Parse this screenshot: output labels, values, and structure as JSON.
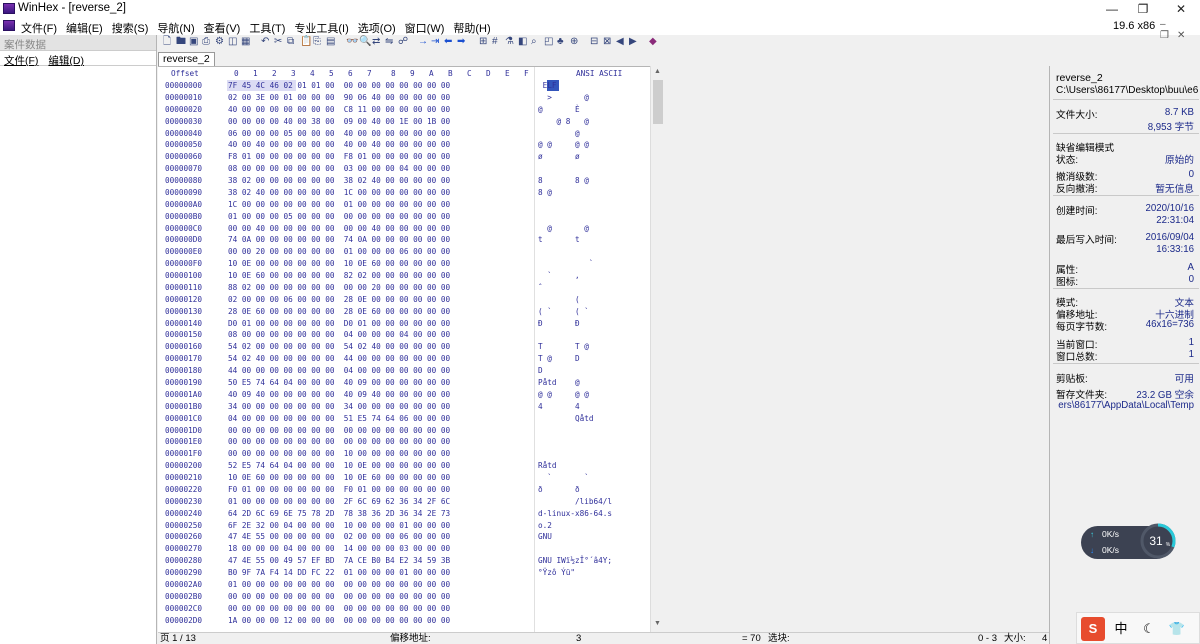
{
  "window": {
    "app_name": "WinHex",
    "title": "WinHex - [reverse_2]",
    "minimize_icon": "—",
    "maximize_icon": "❐",
    "close_icon": "✕"
  },
  "menubar": {
    "items": [
      "文件(F)",
      "编辑(E)",
      "搜索(S)",
      "导航(N)",
      "查看(V)",
      "工具(T)",
      "专业工具(I)",
      "选项(O)",
      "窗口(W)",
      "帮助(H)"
    ],
    "version": "19.6 x86"
  },
  "case_panel": {
    "title": "案件数据",
    "menu": [
      "文件(F)",
      "编辑(D)"
    ]
  },
  "tabs": [
    "reverse_2"
  ],
  "hex_header": {
    "offset_label": "Offset",
    "columns": [
      "0",
      "1",
      "2",
      "3",
      "4",
      "5",
      "6",
      "7",
      "8",
      "9",
      "A",
      "B",
      "C",
      "D",
      "E",
      "F"
    ],
    "ascii_label": "ANSI ASCII"
  },
  "hex_rows": [
    {
      "offset": "00000000",
      "hex": "7F 45 4C 46 02 01 01 00  00 00 00 00 00 00 00 00",
      "ascii": " ELF"
    },
    {
      "offset": "00000010",
      "hex": "02 00 3E 00 01 00 00 00  90 06 40 00 00 00 00 00",
      "ascii": "  >       @"
    },
    {
      "offset": "00000020",
      "hex": "40 00 00 00 00 00 00 00  C8 11 00 00 00 00 00 00",
      "ascii": "@       È"
    },
    {
      "offset": "00000030",
      "hex": "00 00 00 00 40 00 38 00  09 00 40 00 1E 00 1B 00",
      "ascii": "    @ 8   @"
    },
    {
      "offset": "00000040",
      "hex": "06 00 00 00 05 00 00 00  40 00 00 00 00 00 00 00",
      "ascii": "        @"
    },
    {
      "offset": "00000050",
      "hex": "40 00 40 00 00 00 00 00  40 00 40 00 00 00 00 00",
      "ascii": "@ @     @ @"
    },
    {
      "offset": "00000060",
      "hex": "F8 01 00 00 00 00 00 00  F8 01 00 00 00 00 00 00",
      "ascii": "ø       ø"
    },
    {
      "offset": "00000070",
      "hex": "08 00 00 00 00 00 00 00  03 00 00 00 04 00 00 00",
      "ascii": ""
    },
    {
      "offset": "00000080",
      "hex": "38 02 00 00 00 00 00 00  38 02 40 00 00 00 00 00",
      "ascii": "8       8 @"
    },
    {
      "offset": "00000090",
      "hex": "38 02 40 00 00 00 00 00  1C 00 00 00 00 00 00 00",
      "ascii": "8 @"
    },
    {
      "offset": "000000A0",
      "hex": "1C 00 00 00 00 00 00 00  01 00 00 00 00 00 00 00",
      "ascii": ""
    },
    {
      "offset": "000000B0",
      "hex": "01 00 00 00 05 00 00 00  00 00 00 00 00 00 00 00",
      "ascii": ""
    },
    {
      "offset": "000000C0",
      "hex": "00 00 40 00 00 00 00 00  00 00 40 00 00 00 00 00",
      "ascii": "  @       @"
    },
    {
      "offset": "000000D0",
      "hex": "74 0A 00 00 00 00 00 00  74 0A 00 00 00 00 00 00",
      "ascii": "t       t"
    },
    {
      "offset": "000000E0",
      "hex": "00 00 20 00 00 00 00 00  01 00 00 00 06 00 00 00",
      "ascii": ""
    },
    {
      "offset": "000000F0",
      "hex": "10 0E 00 00 00 00 00 00  10 0E 60 00 00 00 00 00",
      "ascii": "           `"
    },
    {
      "offset": "00000100",
      "hex": "10 0E 60 00 00 00 00 00  82 02 00 00 00 00 00 00",
      "ascii": "  `     ‚"
    },
    {
      "offset": "00000110",
      "hex": "88 02 00 00 00 00 00 00  00 00 20 00 00 00 00 00",
      "ascii": "ˆ"
    },
    {
      "offset": "00000120",
      "hex": "02 00 00 00 06 00 00 00  28 0E 00 00 00 00 00 00",
      "ascii": "        ("
    },
    {
      "offset": "00000130",
      "hex": "28 0E 60 00 00 00 00 00  28 0E 60 00 00 00 00 00",
      "ascii": "( `     ( `"
    },
    {
      "offset": "00000140",
      "hex": "D0 01 00 00 00 00 00 00  D0 01 00 00 00 00 00 00",
      "ascii": "Ð       Ð"
    },
    {
      "offset": "00000150",
      "hex": "08 00 00 00 00 00 00 00  04 00 00 00 04 00 00 00",
      "ascii": ""
    },
    {
      "offset": "00000160",
      "hex": "54 02 00 00 00 00 00 00  54 02 40 00 00 00 00 00",
      "ascii": "T       T @"
    },
    {
      "offset": "00000170",
      "hex": "54 02 40 00 00 00 00 00  44 00 00 00 00 00 00 00",
      "ascii": "T @     D"
    },
    {
      "offset": "00000180",
      "hex": "44 00 00 00 00 00 00 00  04 00 00 00 00 00 00 00",
      "ascii": "D"
    },
    {
      "offset": "00000190",
      "hex": "50 E5 74 64 04 00 00 00  40 09 00 00 00 00 00 00",
      "ascii": "Påtd    @"
    },
    {
      "offset": "000001A0",
      "hex": "40 09 40 00 00 00 00 00  40 09 40 00 00 00 00 00",
      "ascii": "@ @     @ @"
    },
    {
      "offset": "000001B0",
      "hex": "34 00 00 00 00 00 00 00  34 00 00 00 00 00 00 00",
      "ascii": "4       4"
    },
    {
      "offset": "000001C0",
      "hex": "04 00 00 00 00 00 00 00  51 E5 74 64 06 00 00 00",
      "ascii": "        Qåtd"
    },
    {
      "offset": "000001D0",
      "hex": "00 00 00 00 00 00 00 00  00 00 00 00 00 00 00 00",
      "ascii": ""
    },
    {
      "offset": "000001E0",
      "hex": "00 00 00 00 00 00 00 00  00 00 00 00 00 00 00 00",
      "ascii": ""
    },
    {
      "offset": "000001F0",
      "hex": "00 00 00 00 00 00 00 00  10 00 00 00 00 00 00 00",
      "ascii": ""
    },
    {
      "offset": "00000200",
      "hex": "52 E5 74 64 04 00 00 00  10 0E 00 00 00 00 00 00",
      "ascii": "Råtd"
    },
    {
      "offset": "00000210",
      "hex": "10 0E 60 00 00 00 00 00  10 0E 60 00 00 00 00 00",
      "ascii": "  `       `"
    },
    {
      "offset": "00000220",
      "hex": "F0 01 00 00 00 00 00 00  F0 01 00 00 00 00 00 00",
      "ascii": "ð       ð"
    },
    {
      "offset": "00000230",
      "hex": "01 00 00 00 00 00 00 00  2F 6C 69 62 36 34 2F 6C",
      "ascii": "        /lib64/l"
    },
    {
      "offset": "00000240",
      "hex": "64 2D 6C 69 6E 75 78 2D  78 38 36 2D 36 34 2E 73",
      "ascii": "d-linux-x86-64.s"
    },
    {
      "offset": "00000250",
      "hex": "6F 2E 32 00 04 00 00 00  10 00 00 00 01 00 00 00",
      "ascii": "o.2"
    },
    {
      "offset": "00000260",
      "hex": "47 4E 55 00 00 00 00 00  02 00 00 00 06 00 00 00",
      "ascii": "GNU"
    },
    {
      "offset": "00000270",
      "hex": "18 00 00 00 04 00 00 00  14 00 00 00 03 00 00 00",
      "ascii": ""
    },
    {
      "offset": "00000280",
      "hex": "47 4E 55 00 49 57 EF BD  7A CE B0 B4 E2 34 59 3B",
      "ascii": "GNU IWï½zÎ°´â4Y;"
    },
    {
      "offset": "00000290",
      "hex": "B0 9F 7A F4 14 DD FC 22  01 00 00 00 01 00 00 00",
      "ascii": "°Ÿzô Ýü\""
    },
    {
      "offset": "000002A0",
      "hex": "01 00 00 00 00 00 00 00  00 00 00 00 00 00 00 00",
      "ascii": ""
    },
    {
      "offset": "000002B0",
      "hex": "00 00 00 00 00 00 00 00  00 00 00 00 00 00 00 00",
      "ascii": ""
    },
    {
      "offset": "000002C0",
      "hex": "00 00 00 00 00 00 00 00  00 00 00 00 00 00 00 00",
      "ascii": ""
    },
    {
      "offset": "000002D0",
      "hex": "1A 00 00 00 12 00 00 00  00 00 00 00 00 00 00 00",
      "ascii": ""
    }
  ],
  "info_panel": {
    "filename": "reverse_2",
    "path": "C:\\Users\\86177\\Desktop\\buu\\e6",
    "file_size_label": "文件大小:",
    "file_size_kb": "8.7 KB",
    "file_size_bytes": "8,953 字节",
    "edit_mode_label": "缺省编辑模式",
    "state_label": "状态:",
    "state_value": "原始的",
    "undo_level_label": "撤消级数:",
    "undo_level_value": "0",
    "reverse_undo_label": "反向撤消:",
    "reverse_undo_value": "暂无信息",
    "created_label": "创建时间:",
    "created_date": "2020/10/16",
    "created_time": "22:31:04",
    "modified_label": "最后写入时间:",
    "modified_date": "2016/09/04",
    "modified_time": "16:33:16",
    "attr_label": "属性:",
    "attr_value": "A",
    "icon_label": "图标:",
    "icon_value": "0",
    "mode_label": "模式:",
    "mode_value": "文本",
    "offset_addr_label": "偏移地址:",
    "offset_addr_value": "十六进制",
    "bytes_per_page_label": "每页字节数:",
    "bytes_per_page_value": "46x16=736",
    "current_window_label": "当前窗口:",
    "current_window_value": "1",
    "window_total_label": "窗口总数:",
    "window_total_value": "1",
    "clipboard_label": "剪贴板:",
    "clipboard_value": "可用",
    "temp_folder_label": "暂存文件夹:",
    "temp_folder_value": "23.2 GB 空余",
    "temp_folder_path": "ers\\86177\\AppData\\Local\\Temp"
  },
  "statusbar": {
    "page": "页 1 / 13",
    "offset_label": "偏移地址:",
    "offset_value": "3",
    "value": "= 70",
    "selection_label": "选块:",
    "selection_range": "0 - 3",
    "size_label": "大小:",
    "size_value": "4"
  },
  "net_widget": {
    "up": "0K/s",
    "down": "0K/s",
    "cpu_percent": "31",
    "percent_sign": "%",
    "accent": "#29c9d9"
  },
  "ime_bar": {
    "s_icon": "S",
    "lang": "中",
    "moon_icon": "☾",
    "shirt_icon": "👕"
  },
  "colors": {
    "hex_text": "#2f2f9a",
    "accent_dark": "#35467c",
    "selection": "#dcdcf4",
    "cursor": "#3355bb"
  }
}
